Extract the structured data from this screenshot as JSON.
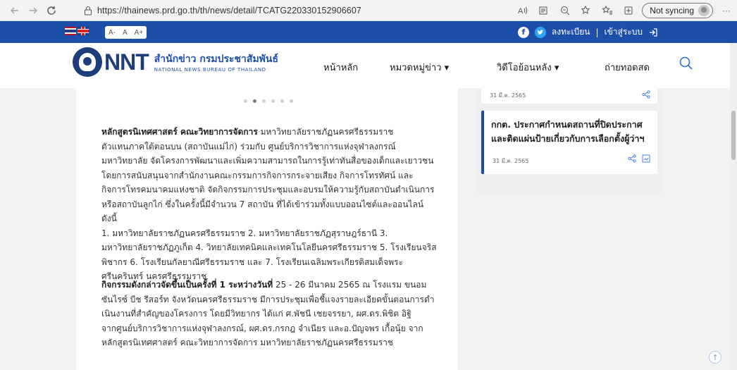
{
  "browser": {
    "url": "https://thainews.prd.go.th/th/news/detail/TCATG220330152906607",
    "sync_label": "Not syncing",
    "more_label": "···"
  },
  "topbar": {
    "font_sizes": [
      "A-",
      "A",
      "A+"
    ],
    "auth": {
      "register": "ลงทะเบียน",
      "separator": "|",
      "login": "เข้าสู่ระบบ"
    }
  },
  "header": {
    "logo_nnt": "NNT",
    "logo_th": "สำนักข่าว กรมประชาสัมพันธ์",
    "logo_en": "NATIONAL NEWS BUREAU OF THAILAND",
    "nav": {
      "home": "หน้าหลัก",
      "categories": "หมวดหมู่ข่าว ▾",
      "videos": "วิดีโอย้อนหลัง ▾",
      "live": "ถ่ายทอดสด"
    }
  },
  "article": {
    "p1": [
      {
        "bold": "หลักสูตรนิเทศศาสตร์ คณะวิทยาการจัดการ",
        "text": " มหาวิทยาลัยราชภัฏนครศรีธรรมราช"
      },
      {
        "bold": "",
        "text": "ตัวแทนภาคใต้ตอนบน (สถาบันแม่ไก่) ร่วมกับ ศูนย์บริการวิชาการแห่งจุฬาลงกรณ์"
      },
      {
        "bold": "",
        "text": "มหาวิทยาลัย จัดโครงการพัฒนาและเพิ่มความสามารถในการรู้เท่าทันสื่อของเด็กและเยาวชน"
      },
      {
        "bold": "",
        "text": "โดยการสนับสนุนจากสำนักงานคณะกรรมการกิจการกระจายเสียง กิจการโทรทัศน์ และ"
      },
      {
        "bold": "",
        "text": "กิจการโทรคมนาคมแห่งชาติ จัดกิจกรรมการประชุมและอบรมให้ความรู้กับสถาบันดำเนินการ"
      },
      {
        "bold": "",
        "text": "หรือสถาบันลูกไก่ ซึ่งในครั้งนี้มีจำนวน 7 สถาบัน ที่ได้เข้าร่วมทั้งแบบออนไซต์และออนไลน์ ดังนี้"
      },
      {
        "bold": "",
        "text": "1. มหาวิทยาลัยราชภัฏนครศรีธรรมราช 2. มหาวิทยาลัยราชภัฏสุราษฎร์ธานี 3."
      },
      {
        "bold": "",
        "text": "มหาวิทยาลัยราชภัฏภูเก็ต 4. วิทยาลัยเทคนิคและเทคโนโลยีนครศรีธรรมราช 5. โรงเรียนจริส"
      },
      {
        "bold": "",
        "text": "พิชากร 6. โรงเรียนกัลยาณีศรีธรรมราช และ 7. โรงเรียนเฉลิมพระเกียรติสมเด็จพระ"
      },
      {
        "bold": "",
        "text": "ศรีนครินทร์ นครศรีธรรมราช"
      }
    ],
    "p2": [
      {
        "bold": "กิจกรรมดังกล่าวจัดขึ้นเป็นครั้งที่ 1 ระหว่างวันที่",
        "text": " 25 - 26 มีนาคม 2565 ณ โรงแรม ขนอม"
      },
      {
        "bold": "",
        "text": "ซันไรซ์ บีช รีสอร์ท จังหวัดนครศรีธรรมราช มีการประชุมเพื่อชี้แจงรายละเอียดขั้นตอนการดำ"
      },
      {
        "bold": "",
        "text": "เนินงานที่สำคัญของโครงการ โดยมีวิทยากร ได้แก่ ศ.พัชนี เชยจรรยา, ผศ.ดร.พิชิต อิฐิ"
      },
      {
        "bold": "",
        "text": "จากศูนย์บริการวิชาการแห่งจุฬาลงกรณ์, ผศ.ดร.กรกฎ จำเนียร และอ.ปัญจพร เกื้อนุ้ย จาก"
      },
      {
        "bold": "",
        "text": "หลักสูตรนิเทศศาสตร์ คณะวิทยาการจัดการ มหาวิทยาลัยราชภัฏนครศรีธรรมราช"
      }
    ]
  },
  "sidebar": {
    "card1_date": "31 มี.ค. 2565",
    "card2_title": "กกต. ประกาศกำหนดสถานที่ปิดประกาศและติดแผ่นป้ายเกี่ยวกับการเลือกตั้งผู้ว่าฯ",
    "card2_date": "31 มี.ค. 2565"
  },
  "icons": {
    "back": "arrow-left-icon",
    "forward": "arrow-right-icon",
    "reload": "reload-icon",
    "search": "search-icon"
  },
  "colors": {
    "brand_blue": "#1e4fa8",
    "logo_navy": "#1e3d7b"
  }
}
